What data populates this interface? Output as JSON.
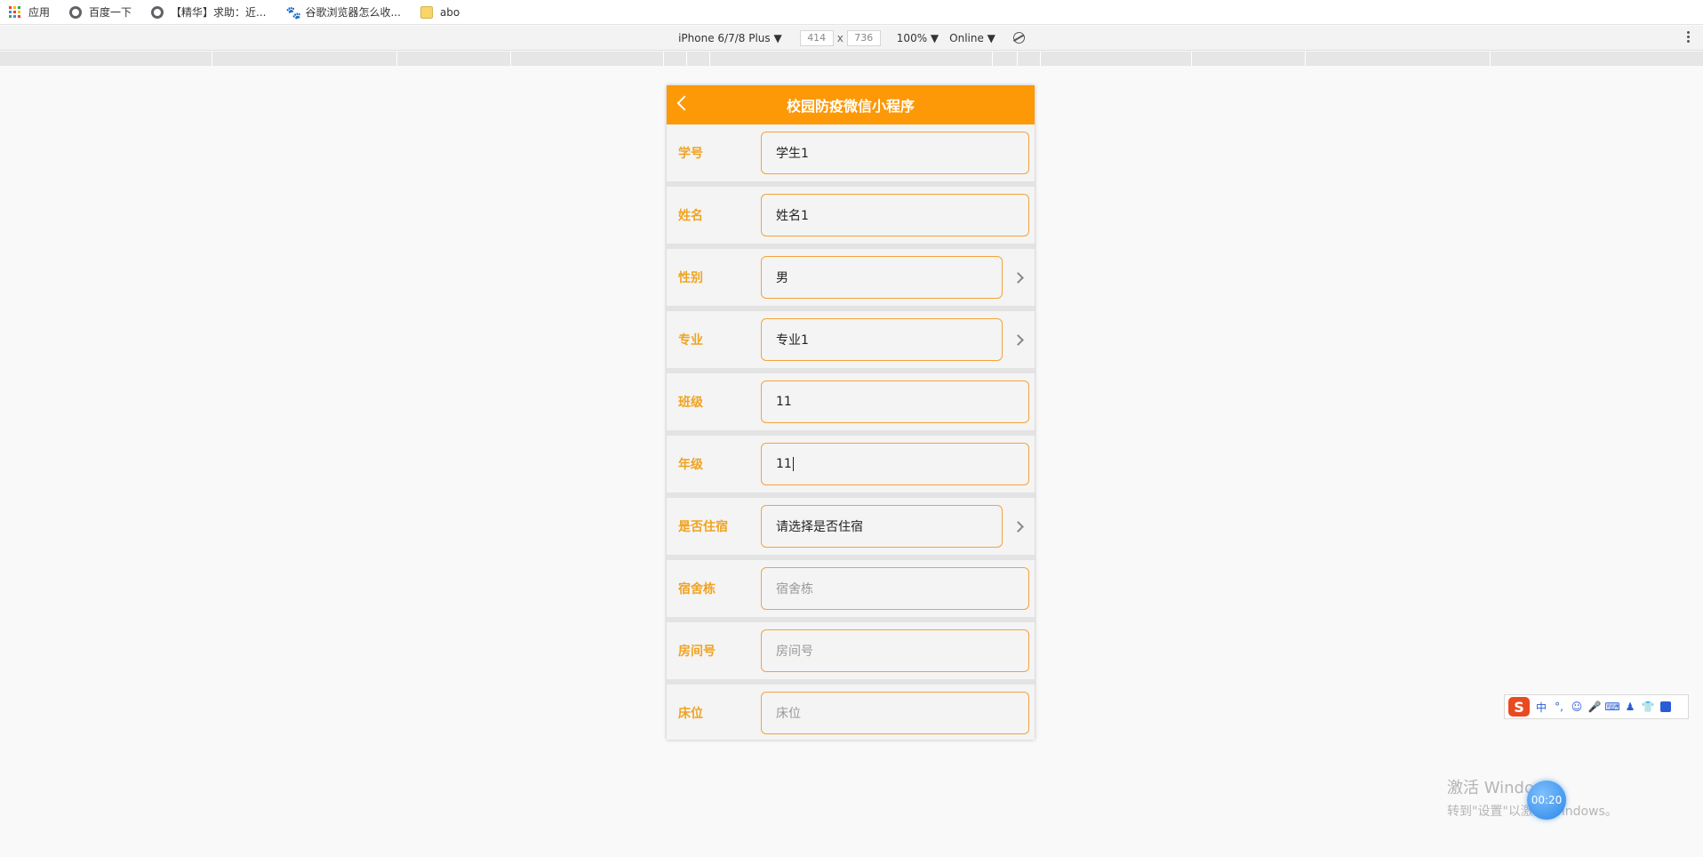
{
  "bookmarks": {
    "items": [
      {
        "label": "应用",
        "icon": "apps-grid-icon"
      },
      {
        "label": "百度一下",
        "icon": "globe-icon"
      },
      {
        "label": "【精华】求助：近...",
        "icon": "globe-icon"
      },
      {
        "label": "谷歌浏览器怎么收...",
        "icon": "paw-icon"
      },
      {
        "label": "abo",
        "icon": "folder-icon"
      }
    ]
  },
  "device_toolbar": {
    "device": "iPhone 6/7/8 Plus ▼",
    "width": "414",
    "times": "x",
    "height": "736",
    "zoom": "100% ▼",
    "network": "Online ▼"
  },
  "app": {
    "title": "校园防疫微信小程序",
    "accent": "#fd9807",
    "label_color": "#f0a320",
    "fields": [
      {
        "label": "学号",
        "value": "学生1",
        "placeholder": false,
        "picker": false
      },
      {
        "label": "姓名",
        "value": "姓名1",
        "placeholder": false,
        "picker": false
      },
      {
        "label": "性别",
        "value": "男",
        "placeholder": false,
        "picker": true
      },
      {
        "label": "专业",
        "value": "专业1",
        "placeholder": false,
        "picker": true
      },
      {
        "label": "班级",
        "value": "11",
        "placeholder": false,
        "picker": false
      },
      {
        "label": "年级",
        "value": "11",
        "placeholder": false,
        "picker": false,
        "focused": true
      },
      {
        "label": "是否住宿",
        "value": "请选择是否住宿",
        "placeholder": false,
        "picker": true
      },
      {
        "label": "宿舍栋",
        "value": "宿舍栋",
        "placeholder": true,
        "picker": false
      },
      {
        "label": "房间号",
        "value": "房间号",
        "placeholder": true,
        "picker": false
      },
      {
        "label": "床位",
        "value": "床位",
        "placeholder": true,
        "picker": false
      }
    ]
  },
  "ime": {
    "logo": "S",
    "mode": "中",
    "punct": "°,"
  },
  "watermark": {
    "title": "激活 Windows",
    "subtitle": "转到\"设置\"以激活 Windows。"
  },
  "timer": "00:20"
}
